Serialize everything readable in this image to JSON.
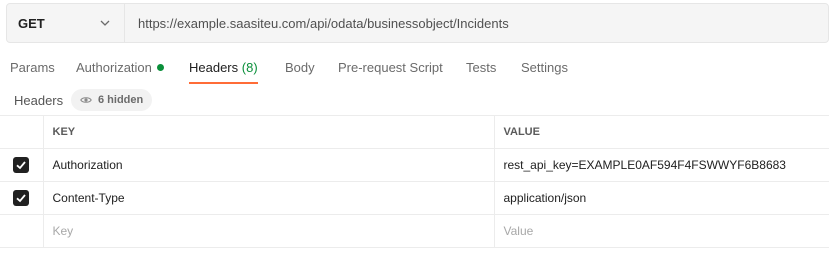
{
  "request": {
    "method": "GET",
    "url": "https://example.saasiteu.com/api/odata/businessobject/Incidents"
  },
  "tabs": [
    {
      "label": "Params"
    },
    {
      "label": "Authorization"
    },
    {
      "label": "Headers",
      "count": "(8)"
    },
    {
      "label": "Body"
    },
    {
      "label": "Pre-request Script"
    },
    {
      "label": "Tests"
    },
    {
      "label": "Settings"
    }
  ],
  "headers_section": {
    "title": "Headers",
    "hidden_label": "6 hidden"
  },
  "table": {
    "columns": [
      "KEY",
      "VALUE"
    ],
    "rows": [
      {
        "key": "Authorization",
        "value": "rest_api_key=EXAMPLE0AF594F4FSWWYF6B8683",
        "checked": true
      },
      {
        "key": "Content-Type",
        "value": "application/json",
        "checked": true
      }
    ],
    "placeholder": {
      "key": "Key",
      "value": "Value"
    }
  },
  "colors": {
    "accent_underline": "#ff6c37",
    "status_green": "#0a8f3a"
  }
}
